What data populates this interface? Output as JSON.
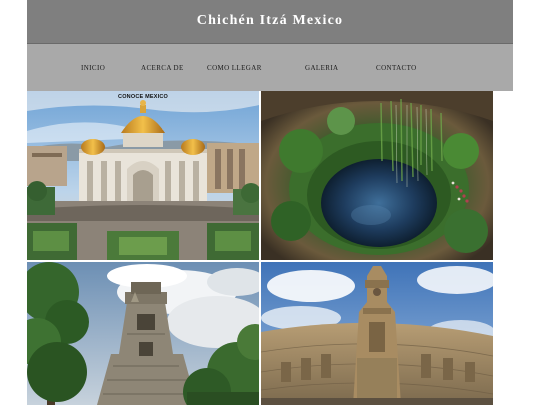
{
  "header": {
    "title": "Chichén Itzá Mexico"
  },
  "nav": {
    "items": [
      {
        "label": "INICIO"
      },
      {
        "label": "ACERCA DE"
      },
      {
        "label": "COMO LLEGAR"
      },
      {
        "label": "GALERIA"
      },
      {
        "label": "CONTACTO"
      }
    ]
  },
  "gallery": {
    "images": [
      {
        "subject": "Palacio de Bellas Artes, Mexico City",
        "overlay_text": "CONOCE MEXICO"
      },
      {
        "subject": "Cenote Ik Kil"
      },
      {
        "subject": "Maya temple ruins in jungle"
      },
      {
        "subject": "Monumento a la Patria, Mérida"
      }
    ]
  },
  "colors": {
    "title_bar": "#7f7f7f",
    "nav_bar": "#a9a9a9",
    "title_text": "#ffffff",
    "nav_text": "#1b1b1b"
  }
}
